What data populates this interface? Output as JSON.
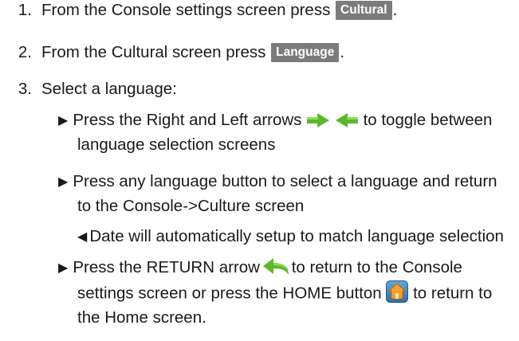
{
  "steps": {
    "s1": {
      "num": "1.",
      "pre": "From the Console settings screen press",
      "button": "Cultural",
      "post": "."
    },
    "s2": {
      "num": "2.",
      "pre": "From the Cultural screen press",
      "button": "Language",
      "post": "."
    },
    "s3": {
      "num": "3.",
      "text": "Select a language:"
    }
  },
  "bullets": {
    "b1": {
      "line1_pre": "Press the Right and Left arrows",
      "line1_post": "to toggle between",
      "line2": "language selection screens",
      "icons": [
        "arrow-right-icon",
        "arrow-left-icon"
      ]
    },
    "b2": {
      "line1": "Press any language button to select a language and return",
      "line2": "to the Console->Culture screen"
    },
    "note": "Date will automatically setup to match language selection",
    "b3": {
      "line1_pre": "Press the RETURN arrow",
      "line1_post": "to return to the Console",
      "line2_pre": "settings screen or press the HOME button",
      "line2_post": "to return to",
      "line3": "the Home screen.",
      "icons": [
        "return-arrow-icon",
        "home-icon"
      ]
    }
  },
  "colors": {
    "button_bg": "#7b7b7b",
    "arrow_green": "#5cb82a",
    "home_orange": "#e8891c"
  }
}
